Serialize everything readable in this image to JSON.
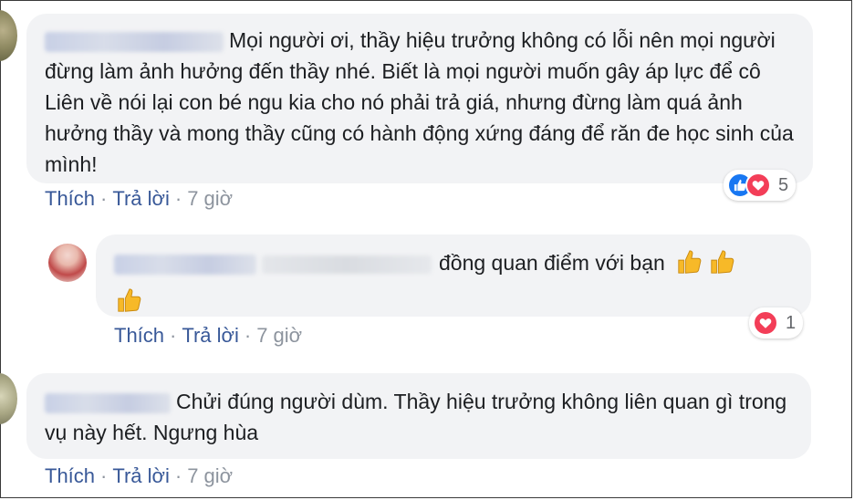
{
  "comments": [
    {
      "text": "Mọi người ơi, thầy hiệu trưởng không có lỗi nên mọi người đừng làm ảnh hưởng đến thầy nhé. Biết là mọi người muốn gây áp lực để cô Liên về nói lại con bé ngu kia cho nó phải trả giá, nhưng đừng làm quá ảnh hưởng thầy và mong thầy cũng có hành động xứng đáng để răn đe học sinh của mình!",
      "like_label": "Thích",
      "reply_label": "Trả lời",
      "time": "7 giờ",
      "reaction_count": "5"
    },
    {
      "text": "đồng quan điểm với bạn",
      "like_label": "Thích",
      "reply_label": "Trả lời",
      "time": "7 giờ",
      "reaction_count": "1"
    },
    {
      "text": "Chửi đúng người dùm. Thầy hiệu trưởng không liên quan gì trong vụ này hết. Ngưng hùa",
      "like_label": "Thích",
      "reply_label": "Trả lời",
      "time": "7 giờ"
    }
  ],
  "colors": {
    "bubble": "#f2f3f5",
    "link": "#385898",
    "muted": "#8d949e",
    "like": "#1877f2",
    "love": "#f33e58"
  },
  "icons": [
    "thumbs-up-emoji-icon",
    "like-reaction-icon",
    "love-reaction-icon"
  ]
}
